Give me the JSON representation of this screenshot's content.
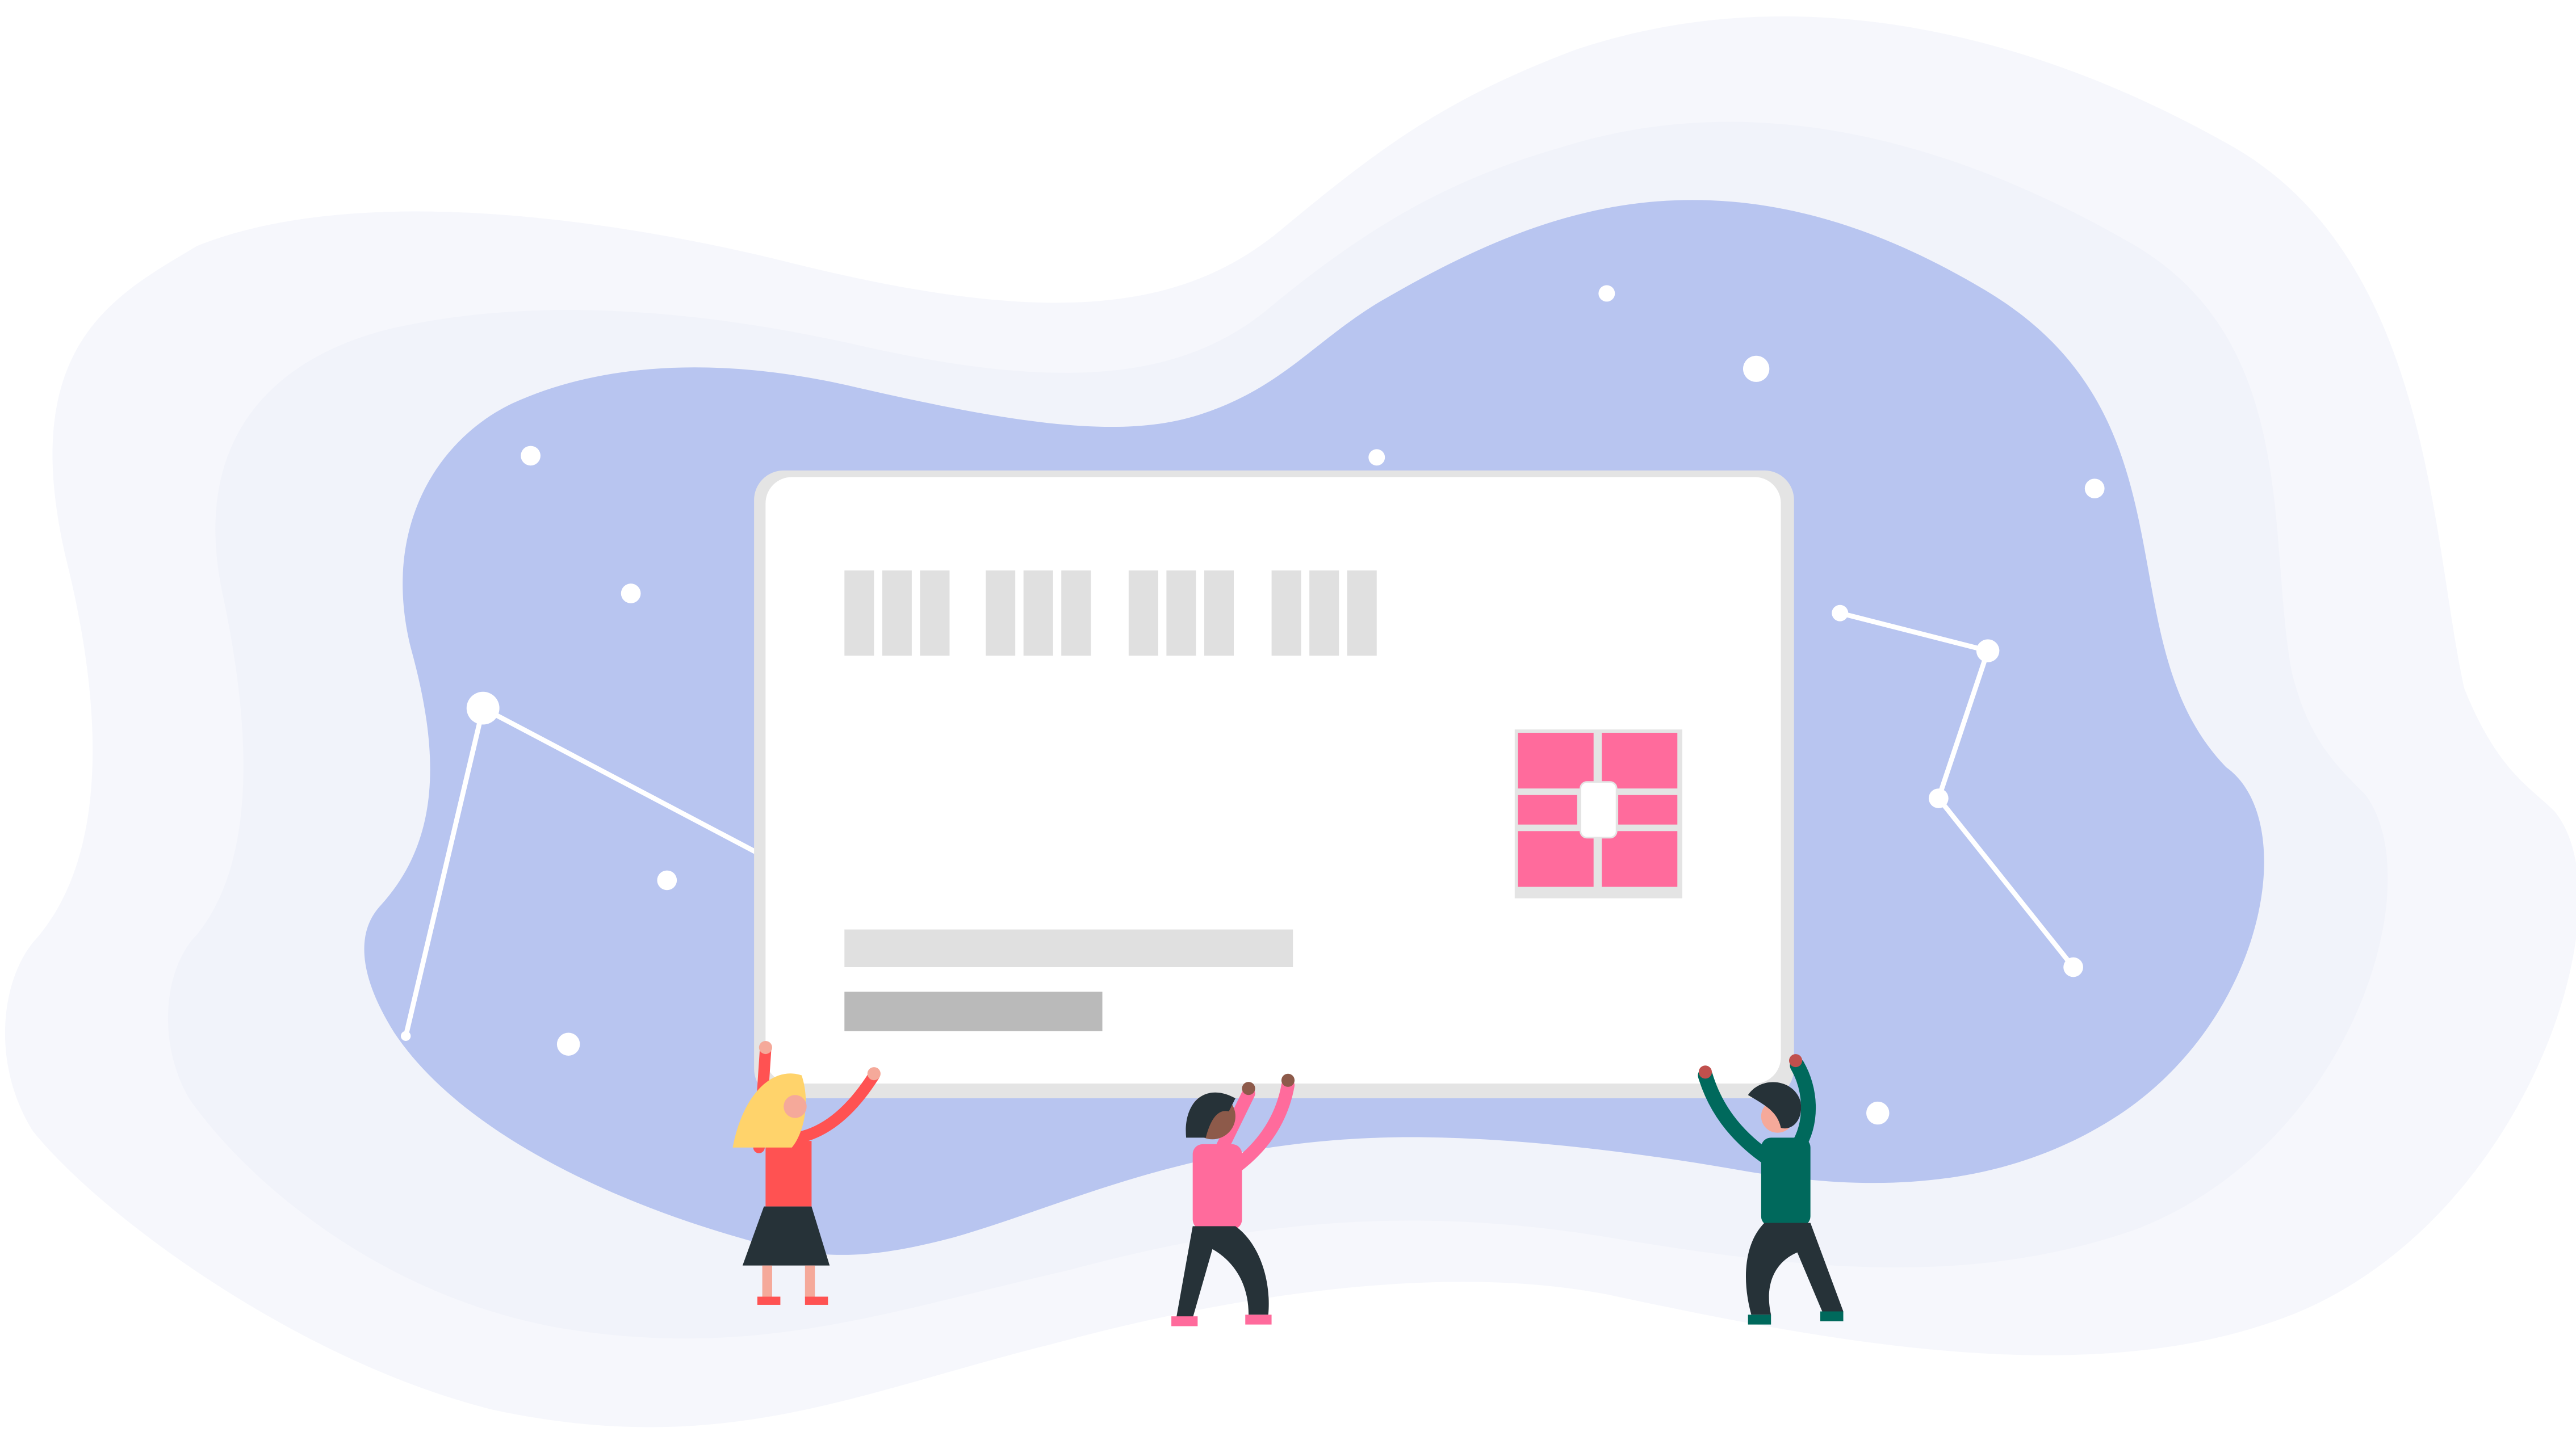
{
  "illustration": {
    "subject": "people-holding-credit-card",
    "colors": {
      "background": "#ffffff",
      "blob_outer": "#f6f7fc",
      "blob_middle": "#f1f3fa",
      "blob_inner": "#b8c5f0",
      "stars": "#ffffff",
      "card_face": "#ffffff",
      "card_edge": "#e4e4e4",
      "card_number_blocks": "#e0e0e0",
      "card_line_light": "#e0e0e0",
      "card_line_dark": "#bababa",
      "chip": "#ff6b9c",
      "skin": "#f5a99a",
      "shirt_red": "#ff5252",
      "hair_yellow": "#ffd36b",
      "shirt_pink": "#ff6b9c",
      "shirt_green": "#00695c",
      "dark": "#263238"
    },
    "card": {
      "number_groups": 4,
      "blocks_per_group": 3,
      "chip": true
    },
    "people": [
      {
        "name": "woman-with-yellow-hair"
      },
      {
        "name": "person-in-pink"
      },
      {
        "name": "man-in-green"
      }
    ]
  }
}
